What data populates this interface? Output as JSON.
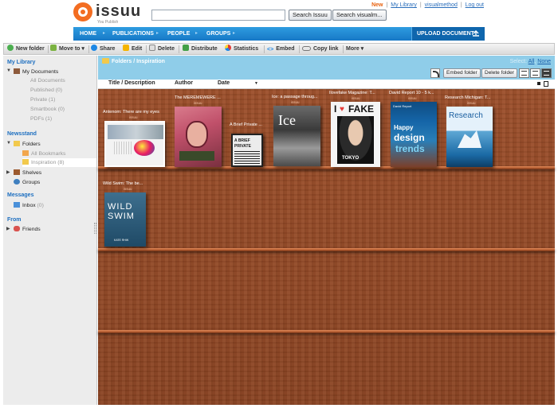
{
  "brand": {
    "name": "issuu",
    "tagline": "You Publish"
  },
  "search": {
    "value": "",
    "btn_issuu": "Search Issuu",
    "btn_user": "Search visualm..."
  },
  "top_links": {
    "new": "New",
    "my_library": "My Library",
    "user": "visualmethod",
    "logout": "Log out",
    "sep": "|"
  },
  "nav": {
    "home": "HOME",
    "publications": "PUBLICATIONS",
    "people": "PEOPLE",
    "groups": "GROUPS",
    "upload": "UPLOAD DOCUMENT",
    "arrow": "▸"
  },
  "toolbar": {
    "new_folder": "New folder",
    "move_to": "Move to ▾",
    "share": "Share",
    "edit": "Edit",
    "delete": "Delete",
    "distribute": "Distribute",
    "statistics": "Statistics",
    "embed": "Embed",
    "copy_link": "Copy link",
    "more": "More ▾"
  },
  "sidebar": {
    "my_library": "My Library",
    "my_documents": "My Documents",
    "all_documents": "All Documents",
    "published": "Published",
    "published_count": "(0)",
    "private": "Private",
    "private_count": "(1)",
    "smartbook": "Smartbook",
    "smartbook_count": "(0)",
    "pdfs": "PDFs",
    "pdfs_count": "(1)",
    "newsstand": "Newsstand",
    "folders": "Folders",
    "all_bookmarks": "All Bookmarks",
    "inspiration": "Inspiration",
    "inspiration_count": "(8)",
    "shelves": "Shelves",
    "groups": "Groups",
    "messages": "Messages",
    "inbox": "Inbox",
    "inbox_count": "(0)",
    "from": "From",
    "friends": "Friends"
  },
  "content": {
    "breadcrumb": "Folders / Inspiration",
    "select_label": "Select:",
    "select_all": "All",
    "select_none": "None",
    "embed_folder": "Embed folder",
    "delete_folder": "Delete folder",
    "col_title": "Title / Description",
    "col_author": "Author",
    "col_date": "Date",
    "sort_arrow": "▼"
  },
  "documents": [
    {
      "title": "Antenom: There are my eyes",
      "source": "issuu"
    },
    {
      "title": "The MEREMEWERE ...",
      "source": "issuu"
    },
    {
      "title": "A Brief Private ...",
      "source": "issuu"
    },
    {
      "title": "Ice: a passage throug...",
      "source": "issuu"
    },
    {
      "title": "Ilovefake Magazine: T...",
      "source": "issuu"
    },
    {
      "title": "David Report 10 - 5 k...",
      "source": "issuu"
    },
    {
      "title": "Research Michigan: T...",
      "source": "issuu"
    },
    {
      "title": "Wild Swim: The be...",
      "source": "issuu"
    }
  ],
  "covers": {
    "ice": "Ice",
    "fake_i": "I",
    "fake_fake": "FAKE",
    "fake_tokyo": "TOKYO",
    "david_byline": "David Report",
    "david_happy": "Happy",
    "david_design": "design",
    "david_trends": "trends",
    "research": "Research",
    "wild": "WILD",
    "swim": "SWIM",
    "swim_author": "KATE RHW",
    "brief_a": "A BRIEF",
    "brief_b": "PRIVATE"
  },
  "colors": {
    "accent": "#1778c6",
    "brand_orange": "#f36d21",
    "shelf": "#8a4322",
    "header_band": "#8fcde9"
  }
}
